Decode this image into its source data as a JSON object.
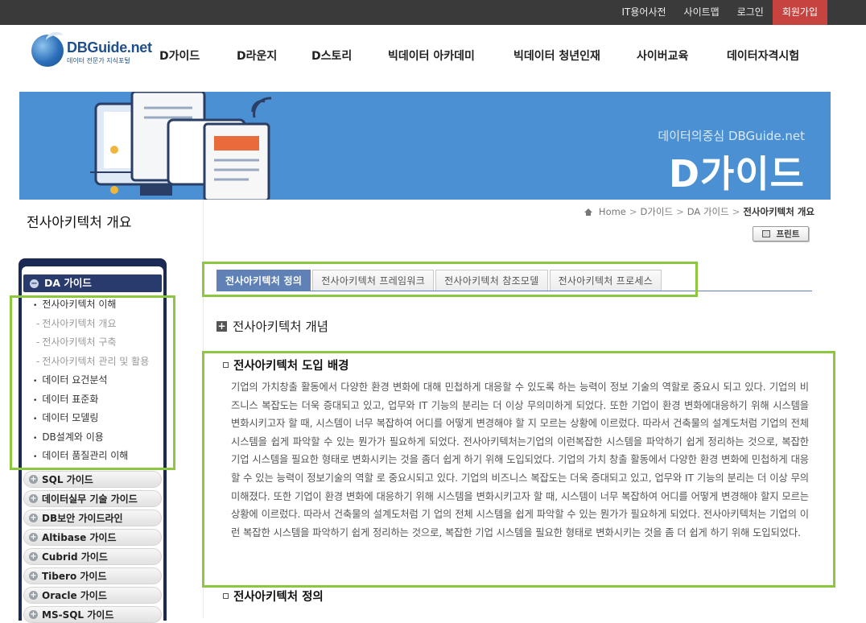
{
  "topbar": {
    "links": [
      "IT용어사전",
      "사이트맵",
      "로그인"
    ],
    "join": "회원가입"
  },
  "header": {
    "brand": "DBGuide.net",
    "tagline": "데이터 전문가 지식포털",
    "menu": [
      "D가이드",
      "D라운지",
      "D스토리",
      "빅데이터 아카데미",
      "빅데이터 청년인재",
      "사이버교육",
      "데이터자격시험"
    ]
  },
  "banner": {
    "subtitle": "데이터의중심 DBGuide.net",
    "title": "D가이드"
  },
  "page": {
    "heading": "전사아키텍처 개요"
  },
  "lnb": {
    "current": "DA 가이드",
    "items": [
      {
        "level": 2,
        "label": "전사아키텍처 이해"
      },
      {
        "level": 3,
        "label": "전사아키텍처 개요"
      },
      {
        "level": 3,
        "label": "전사아키텍처 구축"
      },
      {
        "level": 3,
        "label": "전사아키텍처 관리 및 활용"
      },
      {
        "level": 2,
        "label": "데이터 요건분석"
      },
      {
        "level": 2,
        "label": "데이터 표준화"
      },
      {
        "level": 2,
        "label": "데이터 모델링"
      },
      {
        "level": 2,
        "label": "DB설계와 이용"
      },
      {
        "level": 2,
        "label": "데이터 품질관리 이해"
      }
    ],
    "categories": [
      "SQL 가이드",
      "데이터실무 기술 가이드",
      "DB보안 가이드라인",
      "Altibase 가이드",
      "Cubrid 가이드",
      "Tibero 가이드",
      "Oracle 가이드",
      "MS-SQL 가이드"
    ]
  },
  "breadcrumb": {
    "items": [
      "Home",
      "D가이드",
      "DA 가이드"
    ],
    "current": "전사아키텍처 개요"
  },
  "print_label": "프린트",
  "tabs": [
    "전사아키텍처 정의",
    "전사아키텍처 프레임워크",
    "전사아키텍처 참조모델",
    "전사아키텍처 프로세스"
  ],
  "section_title": "전사아키텍처 개념",
  "subsections": [
    {
      "title": "전사아키텍처 도입 배경",
      "text": "기업의 가치창출 활동에서 다양한 환경 변화에 대해 민첩하게 대응할 수 있도록 하는 능력이 정보 기술의 역할로 중요시 되고 있다. 기업의 비즈니스 복잡도는 더욱 증대되고 있고, 업무와 IT 기능의 분리는 더 이상 무의미하게 되었다. 또한 기업이 환경 변화에대응하기 위해 시스템을 변화시키고자 할 때, 시스템이 너무 복잡하여 어디를 어떻게 변경해야 할 지 모르는 상황에 이르렀다. 따라서 건축물의 설계도처럼 기업의 전체 시스템을 쉽게 파악할 수 있는 뭔가가 필요하게 되었다. 전사아키텍처는기업의 이런복잡한 시스템을 파악하기 쉽게 정리하는 것으로, 복잡한 기업 시스템을 필요한 형태로 변화시키는 것을 좀더 쉽게 하기 위해 도입되었다. 기업의 가치 창출 활동에서 다양한 환경 변화에 민첩하게 대응할 수 있는 능력이 정보기술의 역할 로 중요시되고 있다. 기업의 비즈니스 복잡도는 더욱 증대되고 있고, 업무와 IT 기능의 분리는 더 이상 무의미해졌다. 또한 기업이 환경 변화에 대응하기 위해 시스템을 변화시키고자 할 때, 시스템이 너무 복잡하여 어디를 어떻게 변경해야 할지 모르는 상황에 이르렀다. 따라서 건축물의 설계도처럼 기 업의 전체 시스템을 쉽게 파악할 수 있는 뭔가가 필요하게 되었다. 전사아키텍처는 기업의 이런 복잡한 시스템을 파악하기 쉽게 정리하는 것으로, 복잡한 기업 시스템을 필요한 형태로 변화시키는 것을 좀 더 쉽게 하기 위해 도입되었다."
    },
    {
      "title": "전사아키텍처 정의"
    }
  ],
  "colors": {
    "topbar": "#3a3a3a",
    "join": "#c7433f",
    "banner": "#4b90d2",
    "lnb": "#1b2a55",
    "tab_active": "#5f81b5",
    "highlight": "#8dc63f"
  }
}
